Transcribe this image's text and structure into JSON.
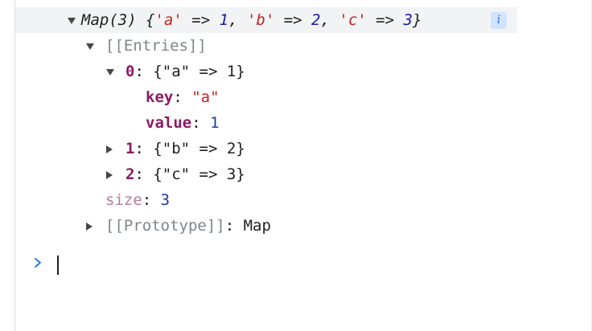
{
  "map_header": {
    "prefix": "Map(3) {",
    "entries": [
      {
        "key": "'a'",
        "arrow": " => ",
        "value": "1",
        "sep": ", "
      },
      {
        "key": "'b'",
        "arrow": " => ",
        "value": "2",
        "sep": ", "
      },
      {
        "key": "'c'",
        "arrow": " => ",
        "value": "3",
        "sep": ""
      }
    ],
    "suffix": "}",
    "info": "i"
  },
  "entries_group": {
    "label": "[[Entries]]",
    "items": [
      {
        "index": "0",
        "colon": ": ",
        "summary": "{\"a\" => 1}",
        "expanded": true
      },
      {
        "index": "1",
        "colon": ": ",
        "summary": "{\"b\" => 2}",
        "expanded": false
      },
      {
        "index": "2",
        "colon": ": ",
        "summary": "{\"c\" => 3}",
        "expanded": false
      }
    ],
    "expanded_entry": {
      "key_label": "key",
      "key_colon": ": ",
      "key_value": "\"a\"",
      "value_label": "value",
      "value_colon": ": ",
      "value_value": "1"
    }
  },
  "size": {
    "label": "size",
    "colon": ": ",
    "value": "3"
  },
  "prototype": {
    "label": "[[Prototype]]",
    "colon": ": ",
    "value": "Map"
  },
  "colors": {
    "key": "#8b1a64",
    "string": "#c5221f",
    "number": "#1a1aa6",
    "prompt": "#1a73e8"
  }
}
